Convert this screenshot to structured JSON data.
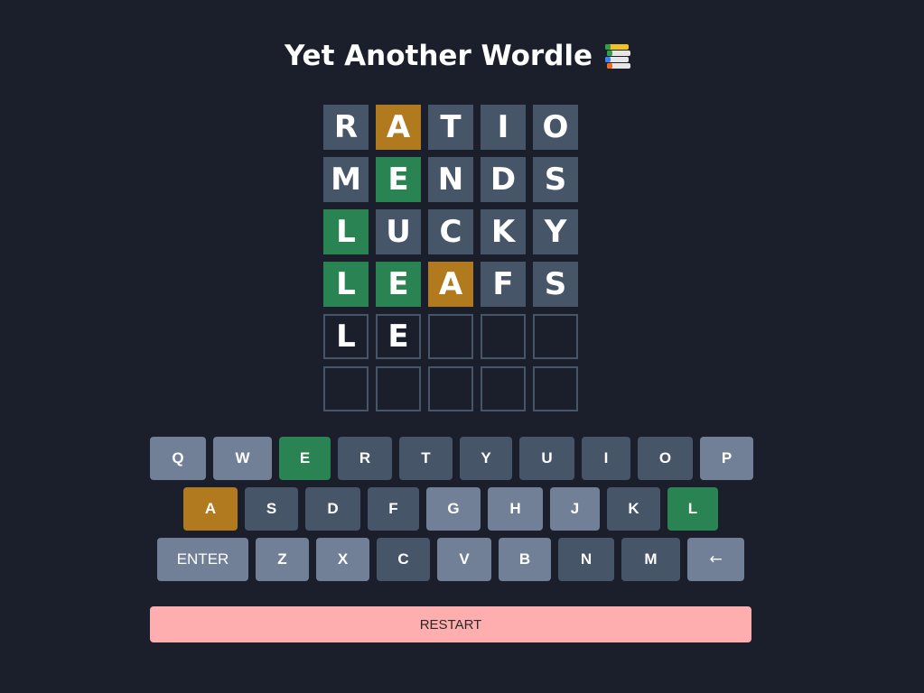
{
  "header": {
    "title": "Yet Another Wordle",
    "icon": "books-icon"
  },
  "colors": {
    "background": "#1b1f2c",
    "absent": "#475569",
    "present": "#b27a1f",
    "correct": "#2a8353",
    "unused_key": "#718096",
    "restart": "#feaeae"
  },
  "board": {
    "rows": [
      [
        {
          "letter": "R",
          "state": "absent"
        },
        {
          "letter": "A",
          "state": "present"
        },
        {
          "letter": "T",
          "state": "absent"
        },
        {
          "letter": "I",
          "state": "absent"
        },
        {
          "letter": "O",
          "state": "absent"
        }
      ],
      [
        {
          "letter": "M",
          "state": "absent"
        },
        {
          "letter": "E",
          "state": "correct"
        },
        {
          "letter": "N",
          "state": "absent"
        },
        {
          "letter": "D",
          "state": "absent"
        },
        {
          "letter": "S",
          "state": "absent"
        }
      ],
      [
        {
          "letter": "L",
          "state": "correct"
        },
        {
          "letter": "U",
          "state": "absent"
        },
        {
          "letter": "C",
          "state": "absent"
        },
        {
          "letter": "K",
          "state": "absent"
        },
        {
          "letter": "Y",
          "state": "absent"
        }
      ],
      [
        {
          "letter": "L",
          "state": "correct"
        },
        {
          "letter": "E",
          "state": "correct"
        },
        {
          "letter": "A",
          "state": "present"
        },
        {
          "letter": "F",
          "state": "absent"
        },
        {
          "letter": "S",
          "state": "absent"
        }
      ],
      [
        {
          "letter": "L",
          "state": "typed"
        },
        {
          "letter": "E",
          "state": "typed"
        },
        {
          "letter": "",
          "state": "empty"
        },
        {
          "letter": "",
          "state": "empty"
        },
        {
          "letter": "",
          "state": "empty"
        }
      ],
      [
        {
          "letter": "",
          "state": "empty"
        },
        {
          "letter": "",
          "state": "empty"
        },
        {
          "letter": "",
          "state": "empty"
        },
        {
          "letter": "",
          "state": "empty"
        },
        {
          "letter": "",
          "state": "empty"
        }
      ]
    ]
  },
  "keyboard": {
    "rows": [
      [
        {
          "label": "Q",
          "state": "unused"
        },
        {
          "label": "W",
          "state": "unused"
        },
        {
          "label": "E",
          "state": "correct"
        },
        {
          "label": "R",
          "state": "absent"
        },
        {
          "label": "T",
          "state": "absent"
        },
        {
          "label": "Y",
          "state": "absent"
        },
        {
          "label": "U",
          "state": "absent"
        },
        {
          "label": "I",
          "state": "absent"
        },
        {
          "label": "O",
          "state": "absent"
        },
        {
          "label": "P",
          "state": "unused"
        }
      ],
      [
        {
          "label": "A",
          "state": "present"
        },
        {
          "label": "S",
          "state": "absent"
        },
        {
          "label": "D",
          "state": "absent"
        },
        {
          "label": "F",
          "state": "absent"
        },
        {
          "label": "G",
          "state": "unused"
        },
        {
          "label": "H",
          "state": "unused"
        },
        {
          "label": "J",
          "state": "unused"
        },
        {
          "label": "K",
          "state": "absent"
        },
        {
          "label": "L",
          "state": "correct"
        }
      ],
      [
        {
          "label": "ENTER",
          "state": "unused"
        },
        {
          "label": "Z",
          "state": "unused"
        },
        {
          "label": "X",
          "state": "unused"
        },
        {
          "label": "C",
          "state": "absent"
        },
        {
          "label": "V",
          "state": "unused"
        },
        {
          "label": "B",
          "state": "unused"
        },
        {
          "label": "N",
          "state": "absent"
        },
        {
          "label": "M",
          "state": "absent"
        },
        {
          "label": "←",
          "state": "unused"
        }
      ]
    ]
  },
  "restart_label": "RESTART"
}
